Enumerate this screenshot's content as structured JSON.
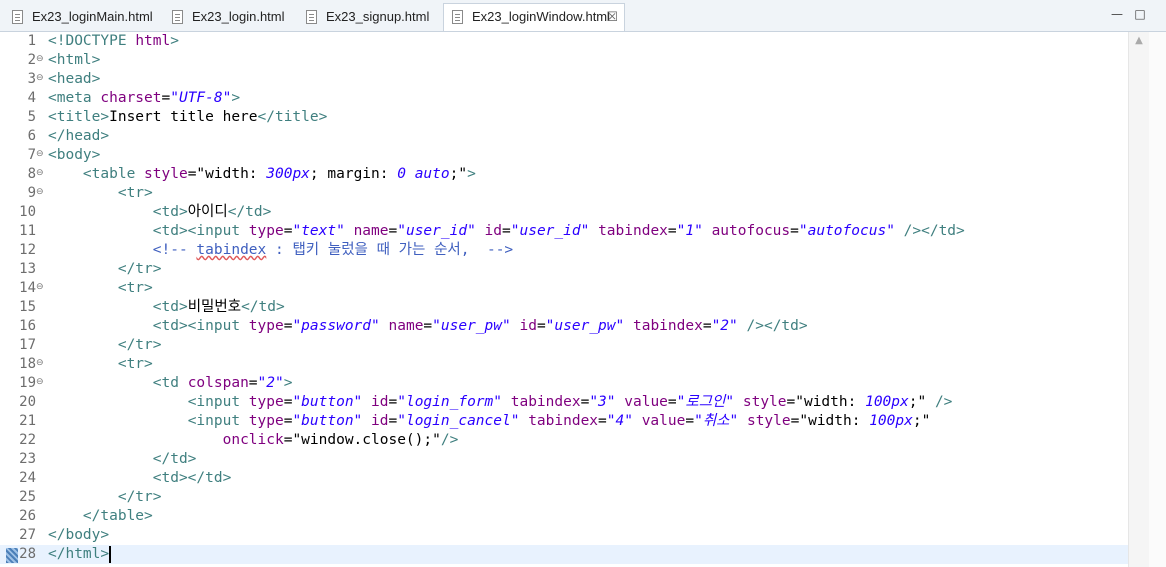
{
  "tabs": [
    {
      "label": "Ex23_loginMain.html",
      "active": false
    },
    {
      "label": "Ex23_login.html",
      "active": false
    },
    {
      "label": "Ex23_signup.html",
      "active": false
    },
    {
      "label": "Ex23_loginWindow.html",
      "active": true
    }
  ],
  "window_controls": {
    "minimize": "—",
    "maximize": "□"
  },
  "icons": {
    "file": "file-icon",
    "close": "close-icon"
  },
  "colors": {
    "tag": "#3f7f7f",
    "attribute": "#7f007f",
    "value": "#2a00ff",
    "comment": "#3f5fbf",
    "current_line": "#e8f2fe"
  },
  "current_line": 28,
  "lines": [
    {
      "n": "1",
      "fold": false,
      "tokens": [
        [
          "tg",
          "<!DOCTYPE "
        ],
        [
          "kw",
          "html"
        ],
        [
          "tg",
          ">"
        ]
      ]
    },
    {
      "n": "2",
      "fold": true,
      "tokens": [
        [
          "tg",
          "<html>"
        ]
      ]
    },
    {
      "n": "3",
      "fold": true,
      "tokens": [
        [
          "tg",
          "<head>"
        ]
      ]
    },
    {
      "n": "4",
      "fold": false,
      "tokens": [
        [
          "tg",
          "<meta "
        ],
        [
          "at",
          "charset"
        ],
        [
          "tx",
          "="
        ],
        [
          "av",
          "\"UTF-8\""
        ],
        [
          "tg",
          ">"
        ]
      ]
    },
    {
      "n": "5",
      "fold": false,
      "tokens": [
        [
          "tg",
          "<title>"
        ],
        [
          "tx",
          "Insert title here"
        ],
        [
          "tg",
          "</title>"
        ]
      ]
    },
    {
      "n": "6",
      "fold": false,
      "tokens": [
        [
          "tg",
          "</head>"
        ]
      ]
    },
    {
      "n": "7",
      "fold": true,
      "tokens": [
        [
          "tg",
          "<body>"
        ]
      ]
    },
    {
      "n": "8",
      "fold": true,
      "tokens": [
        [
          "tx",
          "    "
        ],
        [
          "tg",
          "<table "
        ],
        [
          "at",
          "style"
        ],
        [
          "tx",
          "=\"width: "
        ],
        [
          "av",
          "300px"
        ],
        [
          "tx",
          "; margin: "
        ],
        [
          "av",
          "0 auto"
        ],
        [
          "tx",
          ";\""
        ],
        [
          "tg",
          ">"
        ]
      ]
    },
    {
      "n": "9",
      "fold": true,
      "tokens": [
        [
          "tx",
          "        "
        ],
        [
          "tg",
          "<tr>"
        ]
      ]
    },
    {
      "n": "10",
      "fold": false,
      "tokens": [
        [
          "tx",
          "            "
        ],
        [
          "tg",
          "<td>"
        ],
        [
          "tx",
          "아이디"
        ],
        [
          "tg",
          "</td>"
        ]
      ]
    },
    {
      "n": "11",
      "fold": false,
      "tokens": [
        [
          "tx",
          "            "
        ],
        [
          "tg",
          "<td><input "
        ],
        [
          "at",
          "type"
        ],
        [
          "tx",
          "="
        ],
        [
          "av",
          "\"text\""
        ],
        [
          "tx",
          " "
        ],
        [
          "at",
          "name"
        ],
        [
          "tx",
          "="
        ],
        [
          "av",
          "\"user_id\""
        ],
        [
          "tx",
          " "
        ],
        [
          "at",
          "id"
        ],
        [
          "tx",
          "="
        ],
        [
          "av",
          "\"user_id\""
        ],
        [
          "tx",
          " "
        ],
        [
          "at",
          "tabindex"
        ],
        [
          "tx",
          "="
        ],
        [
          "av",
          "\"1\""
        ],
        [
          "tx",
          " "
        ],
        [
          "at",
          "autofocus"
        ],
        [
          "tx",
          "="
        ],
        [
          "av",
          "\"autofocus\""
        ],
        [
          "tx",
          " "
        ],
        [
          "tg",
          "/></td>"
        ]
      ]
    },
    {
      "n": "12",
      "fold": false,
      "tokens": [
        [
          "tx",
          "            "
        ],
        [
          "cm",
          "<!-- "
        ],
        [
          "cmsq",
          "tabindex"
        ],
        [
          "cm",
          " : 탭키 눌렀을 때 가는 순서,  -->"
        ]
      ]
    },
    {
      "n": "13",
      "fold": false,
      "tokens": [
        [
          "tx",
          "        "
        ],
        [
          "tg",
          "</tr>"
        ]
      ]
    },
    {
      "n": "14",
      "fold": true,
      "tokens": [
        [
          "tx",
          "        "
        ],
        [
          "tg",
          "<tr>"
        ]
      ]
    },
    {
      "n": "15",
      "fold": false,
      "tokens": [
        [
          "tx",
          "            "
        ],
        [
          "tg",
          "<td>"
        ],
        [
          "tx",
          "비밀번호"
        ],
        [
          "tg",
          "</td>"
        ]
      ]
    },
    {
      "n": "16",
      "fold": false,
      "tokens": [
        [
          "tx",
          "            "
        ],
        [
          "tg",
          "<td><input "
        ],
        [
          "at",
          "type"
        ],
        [
          "tx",
          "="
        ],
        [
          "av",
          "\"password\""
        ],
        [
          "tx",
          " "
        ],
        [
          "at",
          "name"
        ],
        [
          "tx",
          "="
        ],
        [
          "av",
          "\"user_pw\""
        ],
        [
          "tx",
          " "
        ],
        [
          "at",
          "id"
        ],
        [
          "tx",
          "="
        ],
        [
          "av",
          "\"user_pw\""
        ],
        [
          "tx",
          " "
        ],
        [
          "at",
          "tabindex"
        ],
        [
          "tx",
          "="
        ],
        [
          "av",
          "\"2\""
        ],
        [
          "tx",
          " "
        ],
        [
          "tg",
          "/></td>"
        ]
      ]
    },
    {
      "n": "17",
      "fold": false,
      "tokens": [
        [
          "tx",
          "        "
        ],
        [
          "tg",
          "</tr>"
        ]
      ]
    },
    {
      "n": "18",
      "fold": true,
      "tokens": [
        [
          "tx",
          "        "
        ],
        [
          "tg",
          "<tr>"
        ]
      ]
    },
    {
      "n": "19",
      "fold": true,
      "tokens": [
        [
          "tx",
          "            "
        ],
        [
          "tg",
          "<td "
        ],
        [
          "at",
          "colspan"
        ],
        [
          "tx",
          "="
        ],
        [
          "av",
          "\"2\""
        ],
        [
          "tg",
          ">"
        ]
      ]
    },
    {
      "n": "20",
      "fold": false,
      "tokens": [
        [
          "tx",
          "                "
        ],
        [
          "tg",
          "<input "
        ],
        [
          "at",
          "type"
        ],
        [
          "tx",
          "="
        ],
        [
          "av",
          "\"button\""
        ],
        [
          "tx",
          " "
        ],
        [
          "at",
          "id"
        ],
        [
          "tx",
          "="
        ],
        [
          "av",
          "\"login_form\""
        ],
        [
          "tx",
          " "
        ],
        [
          "at",
          "tabindex"
        ],
        [
          "tx",
          "="
        ],
        [
          "av",
          "\"3\""
        ],
        [
          "tx",
          " "
        ],
        [
          "at",
          "value"
        ],
        [
          "tx",
          "="
        ],
        [
          "av",
          "\"로그인\""
        ],
        [
          "tx",
          " "
        ],
        [
          "at",
          "style"
        ],
        [
          "tx",
          "=\"width: "
        ],
        [
          "av",
          "100px"
        ],
        [
          "tx",
          ";\" "
        ],
        [
          "tg",
          "/>"
        ]
      ]
    },
    {
      "n": "21",
      "fold": false,
      "tokens": [
        [
          "tx",
          "                "
        ],
        [
          "tg",
          "<input "
        ],
        [
          "at",
          "type"
        ],
        [
          "tx",
          "="
        ],
        [
          "av",
          "\"button\""
        ],
        [
          "tx",
          " "
        ],
        [
          "at",
          "id"
        ],
        [
          "tx",
          "="
        ],
        [
          "av",
          "\"login_cancel\""
        ],
        [
          "tx",
          " "
        ],
        [
          "at",
          "tabindex"
        ],
        [
          "tx",
          "="
        ],
        [
          "av",
          "\"4\""
        ],
        [
          "tx",
          " "
        ],
        [
          "at",
          "value"
        ],
        [
          "tx",
          "="
        ],
        [
          "av",
          "\"취소\""
        ],
        [
          "tx",
          " "
        ],
        [
          "at",
          "style"
        ],
        [
          "tx",
          "=\"width: "
        ],
        [
          "av",
          "100px"
        ],
        [
          "tx",
          ";\""
        ]
      ]
    },
    {
      "n": "22",
      "fold": false,
      "tokens": [
        [
          "tx",
          "                    "
        ],
        [
          "at",
          "onclick"
        ],
        [
          "tx",
          "=\"window.close();\""
        ],
        [
          "tg",
          "/>"
        ]
      ]
    },
    {
      "n": "23",
      "fold": false,
      "tokens": [
        [
          "tx",
          "            "
        ],
        [
          "tg",
          "</td>"
        ]
      ]
    },
    {
      "n": "24",
      "fold": false,
      "tokens": [
        [
          "tx",
          "            "
        ],
        [
          "tg",
          "<td></td>"
        ]
      ]
    },
    {
      "n": "25",
      "fold": false,
      "tokens": [
        [
          "tx",
          "        "
        ],
        [
          "tg",
          "</tr>"
        ]
      ]
    },
    {
      "n": "26",
      "fold": false,
      "tokens": [
        [
          "tx",
          "    "
        ],
        [
          "tg",
          "</table>"
        ]
      ]
    },
    {
      "n": "27",
      "fold": false,
      "tokens": [
        [
          "tg",
          "</body>"
        ]
      ]
    },
    {
      "n": "28",
      "fold": false,
      "tokens": [
        [
          "tg",
          "</html>"
        ]
      ]
    }
  ]
}
